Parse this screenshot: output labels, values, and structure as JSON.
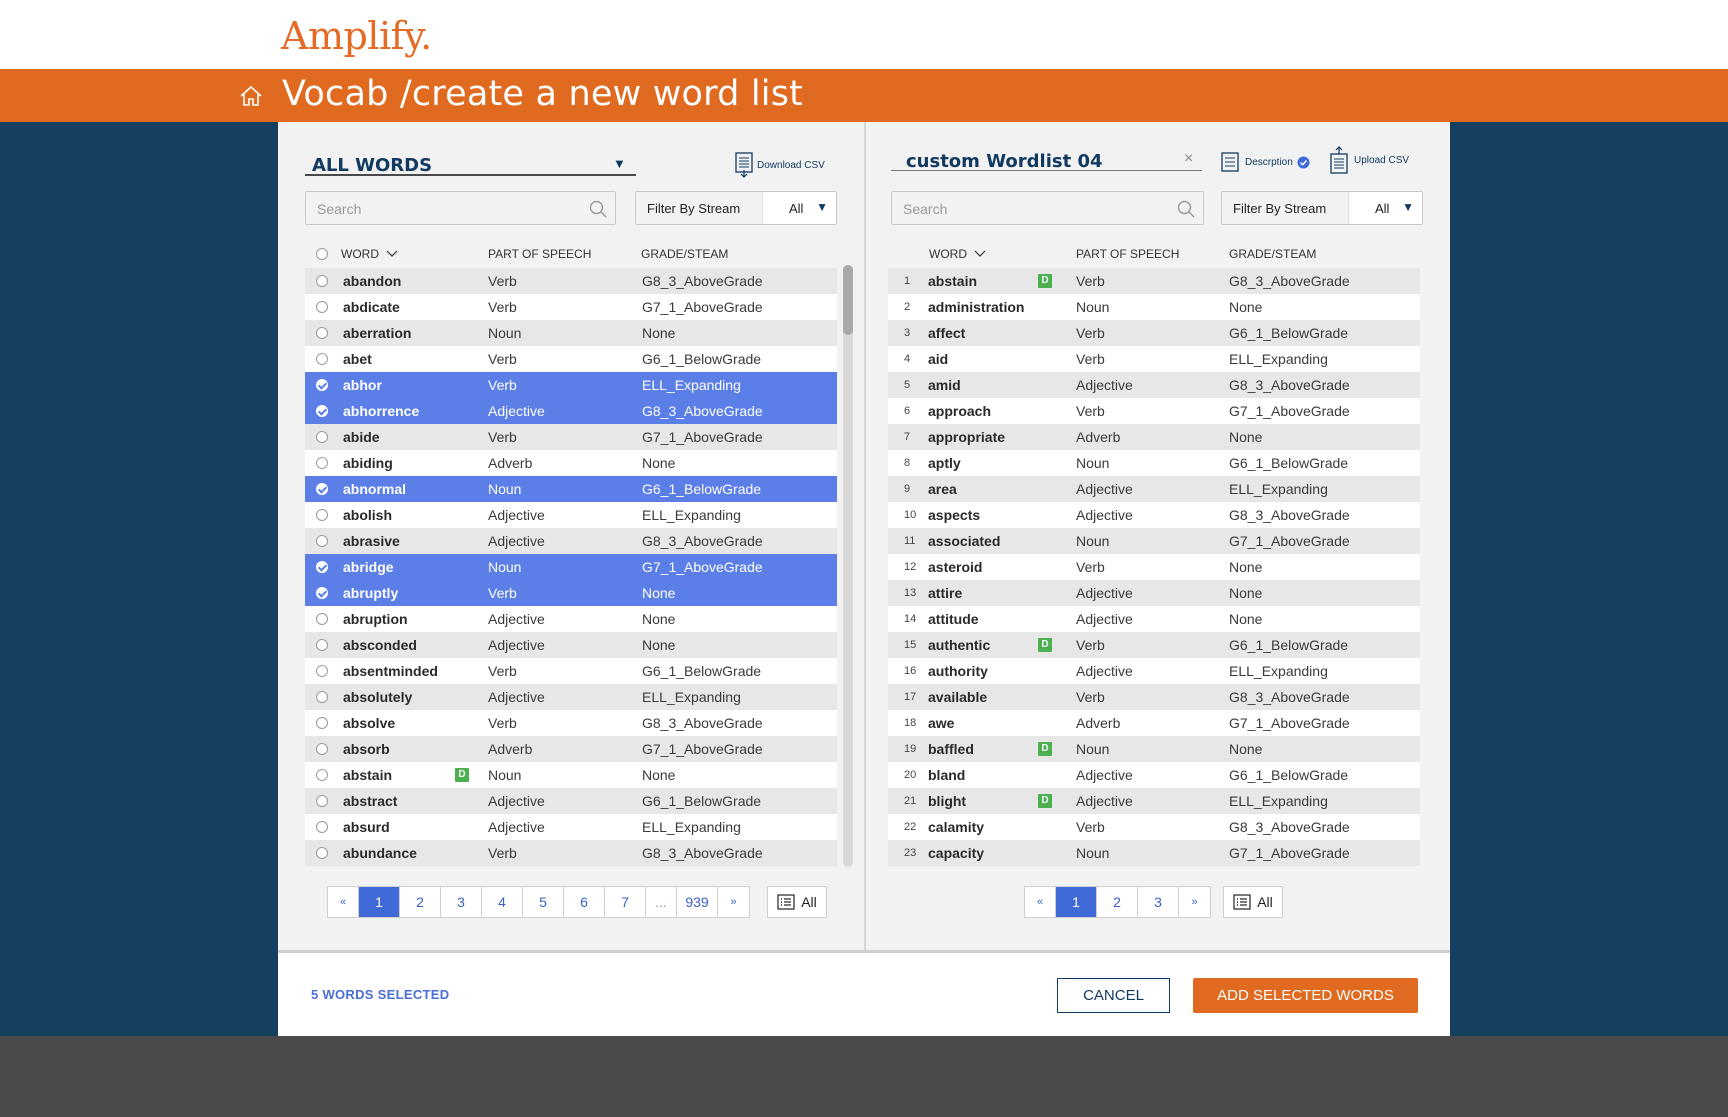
{
  "app": {
    "logo": "Amplify.",
    "title": "Vocab /create a new word list"
  },
  "left": {
    "title": "ALL WORDS",
    "download_label": "Download CSV",
    "search_placeholder": "Search",
    "filter_label": "Filter By Stream",
    "filter_value": "All",
    "headers": {
      "word": "WORD",
      "pos": "PART OF SPEECH",
      "grade": "GRADE/STEAM"
    },
    "rows": [
      {
        "word": "abandon",
        "pos": "Verb",
        "grade": "G8_3_AboveGrade",
        "selected": false,
        "badge": ""
      },
      {
        "word": "abdicate",
        "pos": "Verb",
        "grade": "G7_1_AboveGrade",
        "selected": false,
        "badge": ""
      },
      {
        "word": "aberration",
        "pos": "Noun",
        "grade": "None",
        "selected": false,
        "badge": ""
      },
      {
        "word": "abet",
        "pos": "Verb",
        "grade": "G6_1_BelowGrade",
        "selected": false,
        "badge": ""
      },
      {
        "word": "abhor",
        "pos": "Verb",
        "grade": "ELL_Expanding",
        "selected": true,
        "badge": ""
      },
      {
        "word": "abhorrence",
        "pos": "Adjective",
        "grade": "G8_3_AboveGrade",
        "selected": true,
        "badge": ""
      },
      {
        "word": "abide",
        "pos": "Verb",
        "grade": "G7_1_AboveGrade",
        "selected": false,
        "badge": ""
      },
      {
        "word": "abiding",
        "pos": "Adverb",
        "grade": "None",
        "selected": false,
        "badge": ""
      },
      {
        "word": "abnormal",
        "pos": "Noun",
        "grade": "G6_1_BelowGrade",
        "selected": true,
        "badge": ""
      },
      {
        "word": "abolish",
        "pos": "Adjective",
        "grade": "ELL_Expanding",
        "selected": false,
        "badge": ""
      },
      {
        "word": "abrasive",
        "pos": "Adjective",
        "grade": "G8_3_AboveGrade",
        "selected": false,
        "badge": ""
      },
      {
        "word": "abridge",
        "pos": "Noun",
        "grade": "G7_1_AboveGrade",
        "selected": true,
        "badge": ""
      },
      {
        "word": "abruptly",
        "pos": "Verb",
        "grade": "None",
        "selected": true,
        "badge": ""
      },
      {
        "word": "abruption",
        "pos": "Adjective",
        "grade": "None",
        "selected": false,
        "badge": ""
      },
      {
        "word": "absconded",
        "pos": "Adjective",
        "grade": "None",
        "selected": false,
        "badge": ""
      },
      {
        "word": "absentminded",
        "pos": "Verb",
        "grade": "G6_1_BelowGrade",
        "selected": false,
        "badge": ""
      },
      {
        "word": "absolutely",
        "pos": "Adjective",
        "grade": "ELL_Expanding",
        "selected": false,
        "badge": ""
      },
      {
        "word": "absolve",
        "pos": "Verb",
        "grade": "G8_3_AboveGrade",
        "selected": false,
        "badge": ""
      },
      {
        "word": "absorb",
        "pos": "Adverb",
        "grade": "G7_1_AboveGrade",
        "selected": false,
        "badge": ""
      },
      {
        "word": "abstain",
        "pos": "Noun",
        "grade": "None",
        "selected": false,
        "badge": "D"
      },
      {
        "word": "abstract",
        "pos": "Adjective",
        "grade": "G6_1_BelowGrade",
        "selected": false,
        "badge": ""
      },
      {
        "word": "absurd",
        "pos": "Adjective",
        "grade": "ELL_Expanding",
        "selected": false,
        "badge": ""
      },
      {
        "word": "abundance",
        "pos": "Verb",
        "grade": "G8_3_AboveGrade",
        "selected": false,
        "badge": ""
      }
    ],
    "pager": [
      "«",
      "1",
      "2",
      "3",
      "4",
      "5",
      "6",
      "7",
      "...",
      "939",
      "»"
    ],
    "pager_active": "1",
    "all_label": "All"
  },
  "right": {
    "title": "custom Wordlist 04",
    "clear": "×",
    "description_label": "Descrption",
    "upload_label": "Upload CSV",
    "search_placeholder": "Search",
    "filter_label": "Filter By Stream",
    "filter_value": "All",
    "headers": {
      "word": "WORD",
      "pos": "PART OF SPEECH",
      "grade": "GRADE/STEAM"
    },
    "rows": [
      {
        "num": "1",
        "word": "abstain",
        "pos": "Verb",
        "grade": "G8_3_AboveGrade",
        "badge": "D"
      },
      {
        "num": "2",
        "word": "administration",
        "pos": "Noun",
        "grade": "None",
        "badge": ""
      },
      {
        "num": "3",
        "word": "affect",
        "pos": "Verb",
        "grade": "G6_1_BelowGrade",
        "badge": ""
      },
      {
        "num": "4",
        "word": "aid",
        "pos": "Verb",
        "grade": "ELL_Expanding",
        "badge": ""
      },
      {
        "num": "5",
        "word": "amid",
        "pos": "Adjective",
        "grade": "G8_3_AboveGrade",
        "badge": ""
      },
      {
        "num": "6",
        "word": "approach",
        "pos": "Verb",
        "grade": "G7_1_AboveGrade",
        "badge": ""
      },
      {
        "num": "7",
        "word": "appropriate",
        "pos": "Adverb",
        "grade": "None",
        "badge": ""
      },
      {
        "num": "8",
        "word": "aptly",
        "pos": "Noun",
        "grade": "G6_1_BelowGrade",
        "badge": ""
      },
      {
        "num": "9",
        "word": "area",
        "pos": "Adjective",
        "grade": "ELL_Expanding",
        "badge": ""
      },
      {
        "num": "10",
        "word": "aspects",
        "pos": "Adjective",
        "grade": "G8_3_AboveGrade",
        "badge": ""
      },
      {
        "num": "11",
        "word": "associated",
        "pos": "Noun",
        "grade": "G7_1_AboveGrade",
        "badge": ""
      },
      {
        "num": "12",
        "word": "asteroid",
        "pos": "Verb",
        "grade": "None",
        "badge": ""
      },
      {
        "num": "13",
        "word": "attire",
        "pos": "Adjective",
        "grade": "None",
        "badge": ""
      },
      {
        "num": "14",
        "word": "attitude",
        "pos": "Adjective",
        "grade": "None",
        "badge": ""
      },
      {
        "num": "15",
        "word": "authentic",
        "pos": "Verb",
        "grade": "G6_1_BelowGrade",
        "badge": "D"
      },
      {
        "num": "16",
        "word": "authority",
        "pos": "Adjective",
        "grade": "ELL_Expanding",
        "badge": ""
      },
      {
        "num": "17",
        "word": "available",
        "pos": "Verb",
        "grade": "G8_3_AboveGrade",
        "badge": ""
      },
      {
        "num": "18",
        "word": "awe",
        "pos": "Adverb",
        "grade": "G7_1_AboveGrade",
        "badge": ""
      },
      {
        "num": "19",
        "word": "baffled",
        "pos": "Noun",
        "grade": "None",
        "badge": "D"
      },
      {
        "num": "20",
        "word": "bland",
        "pos": "Adjective",
        "grade": "G6_1_BelowGrade",
        "badge": ""
      },
      {
        "num": "21",
        "word": "blight",
        "pos": "Adjective",
        "grade": "ELL_Expanding",
        "badge": "D"
      },
      {
        "num": "22",
        "word": "calamity",
        "pos": "Verb",
        "grade": "G8_3_AboveGrade",
        "badge": ""
      },
      {
        "num": "23",
        "word": "capacity",
        "pos": "Noun",
        "grade": "G7_1_AboveGrade",
        "badge": ""
      }
    ],
    "pager": [
      "«",
      "1",
      "2",
      "3",
      "»"
    ],
    "pager_active": "1",
    "all_label": "All"
  },
  "footer": {
    "selected_count": "5 WORDS SELECTED",
    "cancel_label": "CANCEL",
    "add_label": "ADD SELECTED WORDS"
  },
  "colors": {
    "brand_orange": "#e06a1f",
    "navy": "#153f5f",
    "selected_row": "#5b7fe6",
    "badge_green": "#4caf50",
    "link_blue": "#3c62c8"
  }
}
